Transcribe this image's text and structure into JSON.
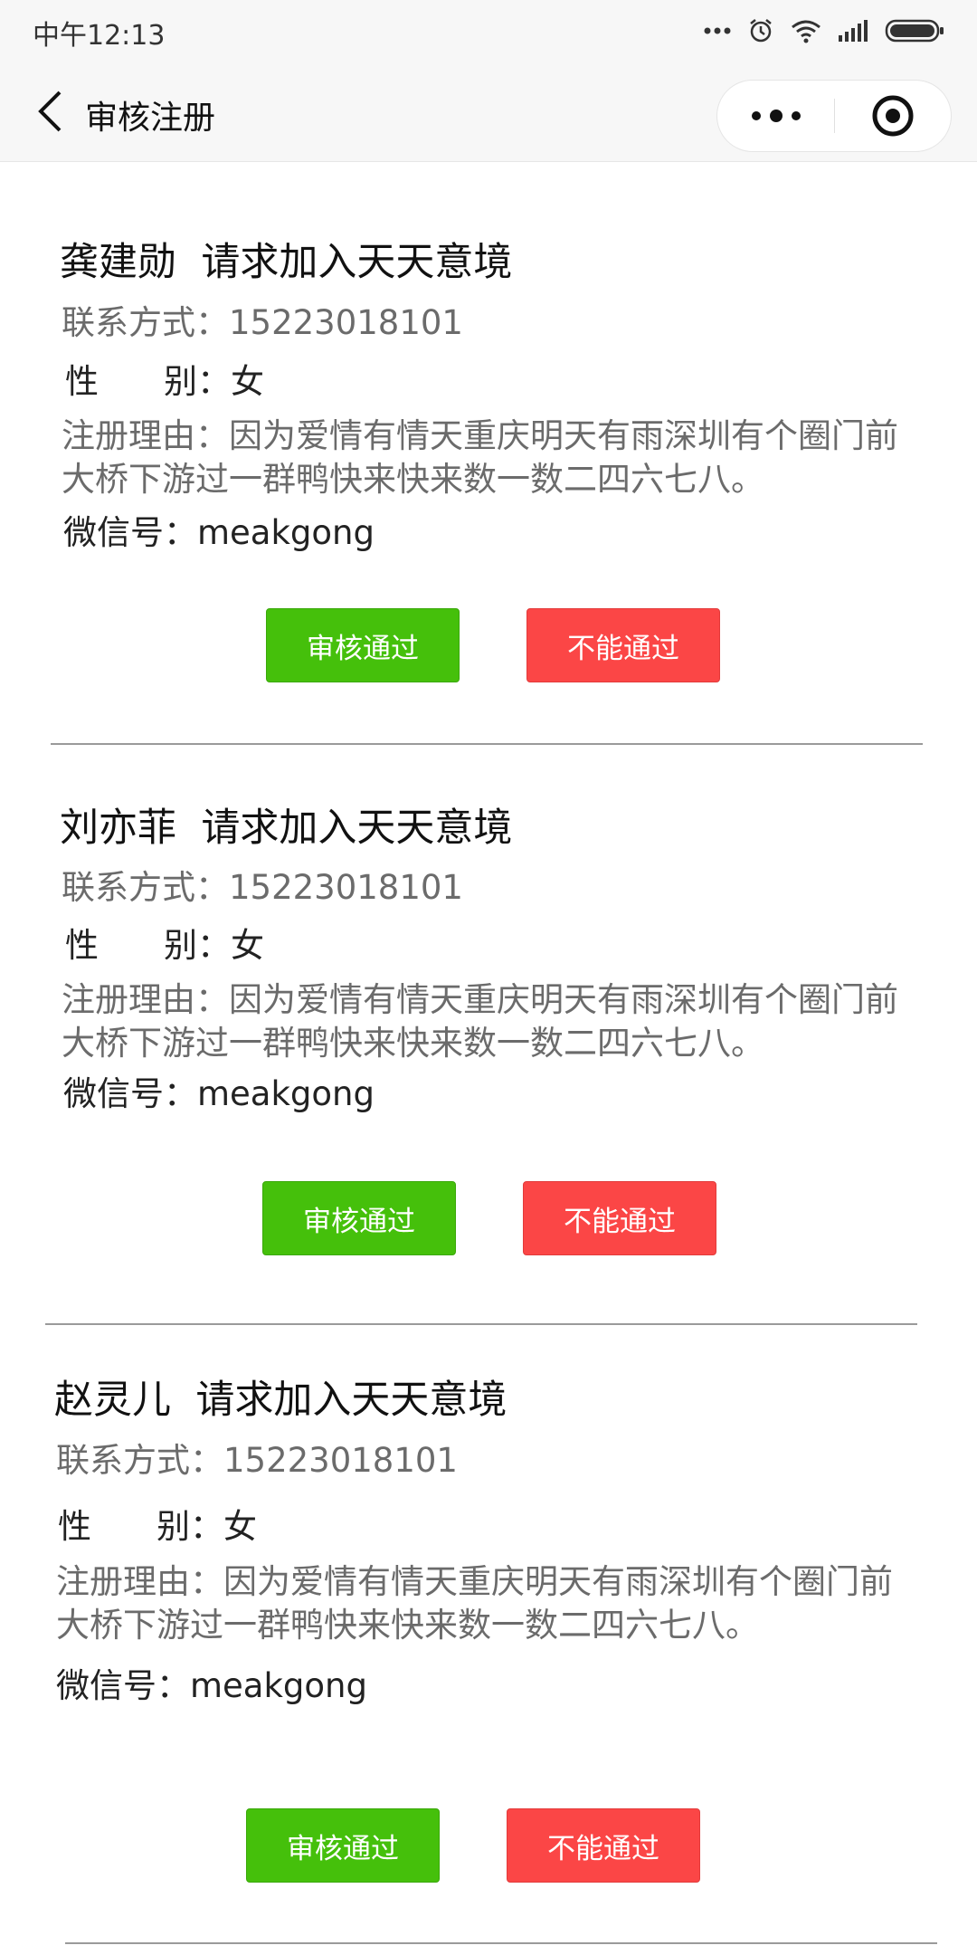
{
  "status_bar": {
    "time": "中午12:13"
  },
  "nav": {
    "title": "审核注册"
  },
  "labels": {
    "contact": "联系方式：",
    "gender_a": "性",
    "gender_b": "别：",
    "reason": "注册理由：",
    "wechat": "微信号：",
    "approve": "审核通过",
    "reject": "不能通过"
  },
  "requests": [
    {
      "name": "龚建勋",
      "action": "请求加入天天意境",
      "contact": "15223018101",
      "gender": "女",
      "reason": "因为爱情有情天重庆明天有雨深圳有个圈门前大桥下游过一群鸭快来快来数一数二四六七八。",
      "wechat": "meakgong"
    },
    {
      "name": "刘亦菲",
      "action": "请求加入天天意境",
      "contact": "15223018101",
      "gender": "女",
      "reason": "因为爱情有情天重庆明天有雨深圳有个圈门前大桥下游过一群鸭快来快来数一数二四六七八。",
      "wechat": "meakgong"
    },
    {
      "name": "赵灵儿",
      "action": "请求加入天天意境",
      "contact": "15223018101",
      "gender": "女",
      "reason": "因为爱情有情天重庆明天有雨深圳有个圈门前大桥下游过一群鸭快来快来数一数二四六七八。",
      "wechat": "meakgong"
    }
  ],
  "colors": {
    "approve": "#45c00b",
    "reject": "#fb4646",
    "divider": "#9a9a9a"
  }
}
